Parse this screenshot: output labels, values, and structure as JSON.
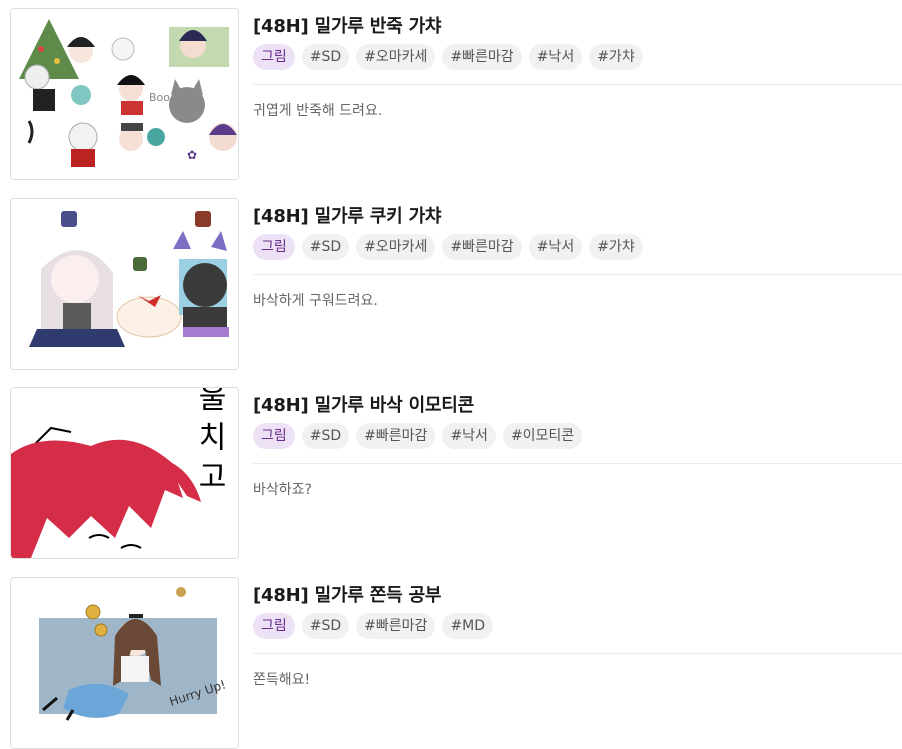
{
  "products": [
    {
      "title": "[48H] 밀가루 반죽 가챠",
      "tags": [
        "그림",
        "#SD",
        "#오마카세",
        "#빠른마감",
        "#낙서",
        "#가챠"
      ],
      "description": "귀엽게 반죽해 드려요.",
      "image_icon": "chibi-character-collage"
    },
    {
      "title": "[48H] 밀가루 쿠키 가챠",
      "tags": [
        "그림",
        "#SD",
        "#오마카세",
        "#빠른마감",
        "#낙서",
        "#가챠"
      ],
      "description": "바삭하게 구워드려요.",
      "image_icon": "chibi-cookie-trio"
    },
    {
      "title": "[48H] 밀가루 바삭 이모티콘",
      "tags": [
        "그림",
        "#SD",
        "#빠른마감",
        "#낙서",
        "#이모티콘"
      ],
      "description": "바삭하죠?",
      "image_icon": "red-hair-emoticon",
      "image_text": "울 치 고"
    },
    {
      "title": "[48H] 밀가루 쫀득 공부",
      "tags": [
        "그림",
        "#SD",
        "#빠른마감",
        "#MD"
      ],
      "description": "쫀득해요!",
      "image_icon": "chibi-girl-illustration",
      "image_text": "Hurry Up!"
    }
  ],
  "colors": {
    "category_tag_bg": "#ede2f5",
    "category_tag_text": "#6a2f8f",
    "tag_bg": "#f1f1f1",
    "tag_text": "#555555"
  }
}
